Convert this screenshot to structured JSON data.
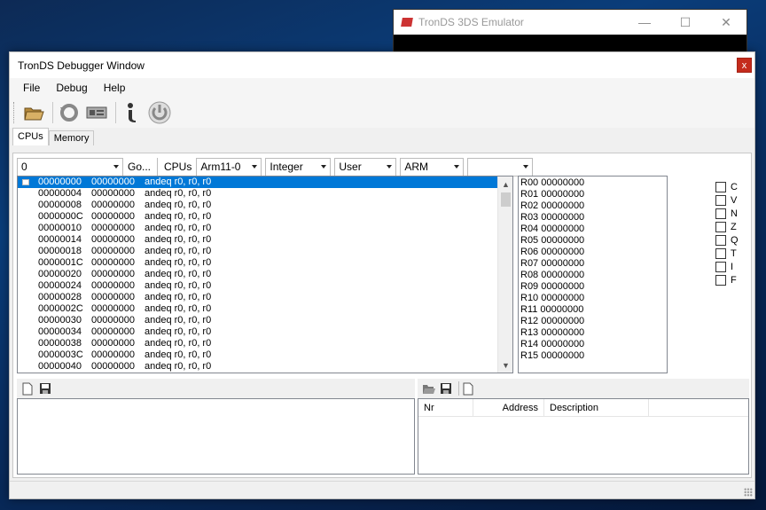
{
  "background_window": {
    "title": "TronDS 3DS Emulator",
    "controls": [
      "—",
      "☐",
      "✕"
    ]
  },
  "window": {
    "title": "TronDS Debugger Window",
    "close": "x"
  },
  "menu": [
    "File",
    "Debug",
    "Help"
  ],
  "tabs": [
    "CPUs",
    "Memory"
  ],
  "controls": {
    "address": "0",
    "go": "Go...",
    "cpus_label": "CPUs",
    "cpu": "Arm11-0",
    "format": "Integer",
    "mode": "User",
    "arch": "ARM",
    "extra": ""
  },
  "disasm": [
    {
      "addr": "00000000",
      "op": "00000000",
      "ins": "andeq r0, r0, r0"
    },
    {
      "addr": "00000004",
      "op": "00000000",
      "ins": "andeq r0, r0, r0"
    },
    {
      "addr": "00000008",
      "op": "00000000",
      "ins": "andeq r0, r0, r0"
    },
    {
      "addr": "0000000C",
      "op": "00000000",
      "ins": "andeq r0, r0, r0"
    },
    {
      "addr": "00000010",
      "op": "00000000",
      "ins": "andeq r0, r0, r0"
    },
    {
      "addr": "00000014",
      "op": "00000000",
      "ins": "andeq r0, r0, r0"
    },
    {
      "addr": "00000018",
      "op": "00000000",
      "ins": "andeq r0, r0, r0"
    },
    {
      "addr": "0000001C",
      "op": "00000000",
      "ins": "andeq r0, r0, r0"
    },
    {
      "addr": "00000020",
      "op": "00000000",
      "ins": "andeq r0, r0, r0"
    },
    {
      "addr": "00000024",
      "op": "00000000",
      "ins": "andeq r0, r0, r0"
    },
    {
      "addr": "00000028",
      "op": "00000000",
      "ins": "andeq r0, r0, r0"
    },
    {
      "addr": "0000002C",
      "op": "00000000",
      "ins": "andeq r0, r0, r0"
    },
    {
      "addr": "00000030",
      "op": "00000000",
      "ins": "andeq r0, r0, r0"
    },
    {
      "addr": "00000034",
      "op": "00000000",
      "ins": "andeq r0, r0, r0"
    },
    {
      "addr": "00000038",
      "op": "00000000",
      "ins": "andeq r0, r0, r0"
    },
    {
      "addr": "0000003C",
      "op": "00000000",
      "ins": "andeq r0, r0, r0"
    },
    {
      "addr": "00000040",
      "op": "00000000",
      "ins": "andeq r0, r0, r0"
    }
  ],
  "registers": [
    "R00 00000000",
    "R01 00000000",
    "R02 00000000",
    "R03 00000000",
    "R04 00000000",
    "R05 00000000",
    "R06 00000000",
    "R07 00000000",
    "R08 00000000",
    "R09 00000000",
    "R10 00000000",
    "R11 00000000",
    "R12 00000000",
    "R13 00000000",
    "R14 00000000",
    "R15 00000000"
  ],
  "flags": [
    "C",
    "V",
    "N",
    "Z",
    "Q",
    "T",
    "I",
    "F"
  ],
  "breakpoints_columns": [
    "Nr",
    "Address",
    "Description"
  ]
}
